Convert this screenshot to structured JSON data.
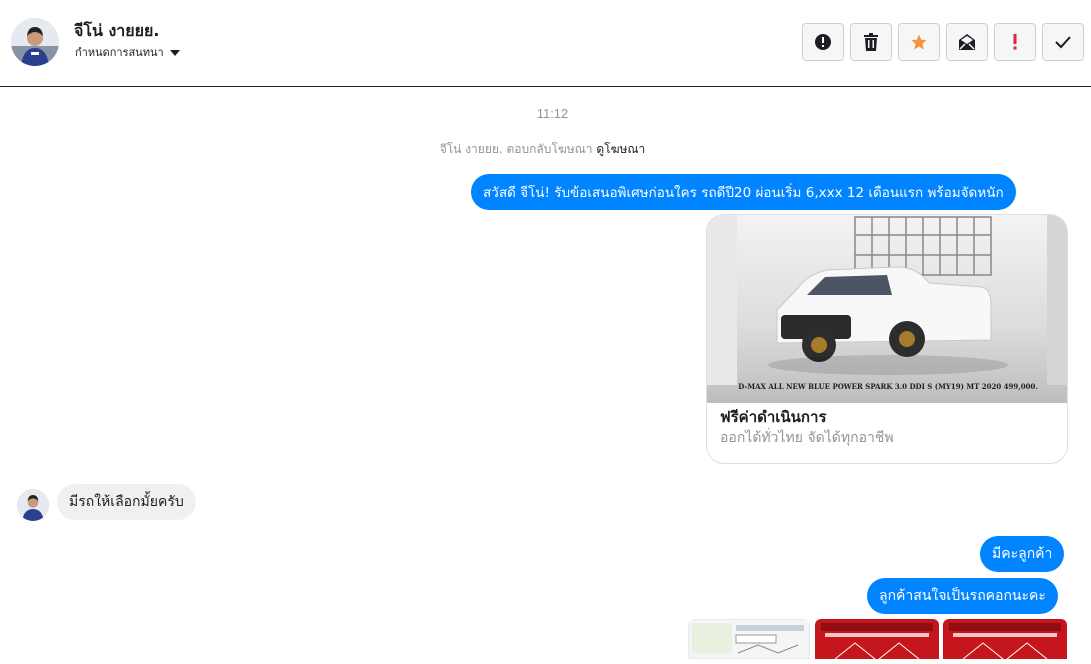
{
  "header": {
    "contact_name": "จีโน่ งายยย.",
    "settings_label": "กำหนดการสนทนา",
    "actions": [
      {
        "icon": "alert-circle-icon",
        "name": "report-button"
      },
      {
        "icon": "trash-icon",
        "name": "delete-button"
      },
      {
        "icon": "star-icon",
        "name": "star-button"
      },
      {
        "icon": "mark-unread-icon",
        "name": "mark-unread-button"
      },
      {
        "icon": "exclamation-icon",
        "name": "spam-button"
      },
      {
        "icon": "check-icon",
        "name": "done-button"
      }
    ]
  },
  "thread": {
    "timestamp": "11:12",
    "ad_reply_prefix": "จีโน่ งายยย. ตอบกลับโฆษณา",
    "ad_link_label": "ดูโฆษณา",
    "messages": {
      "greeting": "สวัสดี จีโน่! รับข้อเสนอพิเศษก่อนใคร รถดีปี20 ผ่อนเริ่ม 6,xxx 12 เดือนแรก  พร้อมจัดหนัก",
      "ad_card": {
        "image_caption": "D-MAX ALL NEW BLUE POWER SPARK 3.0 DDI S (MY19) MT 2020 499,000.",
        "title": "ฟรีค่าดำเนินการ",
        "subtitle": "ออกได้ทั่วไทย จัดได้ทุกอาชีพ"
      },
      "incoming_question": "มีรถให้เลือกมั้ยครับ",
      "reply_1": "มีคะลูกค้า",
      "reply_2": "ลูกค้าสนใจเป็นรถคอกนะคะ"
    }
  },
  "colors": {
    "outgoing_bubble": "#0084ff",
    "incoming_bubble": "#f1f0f0",
    "star": "#f7923b",
    "spam": "#e41e3f"
  }
}
